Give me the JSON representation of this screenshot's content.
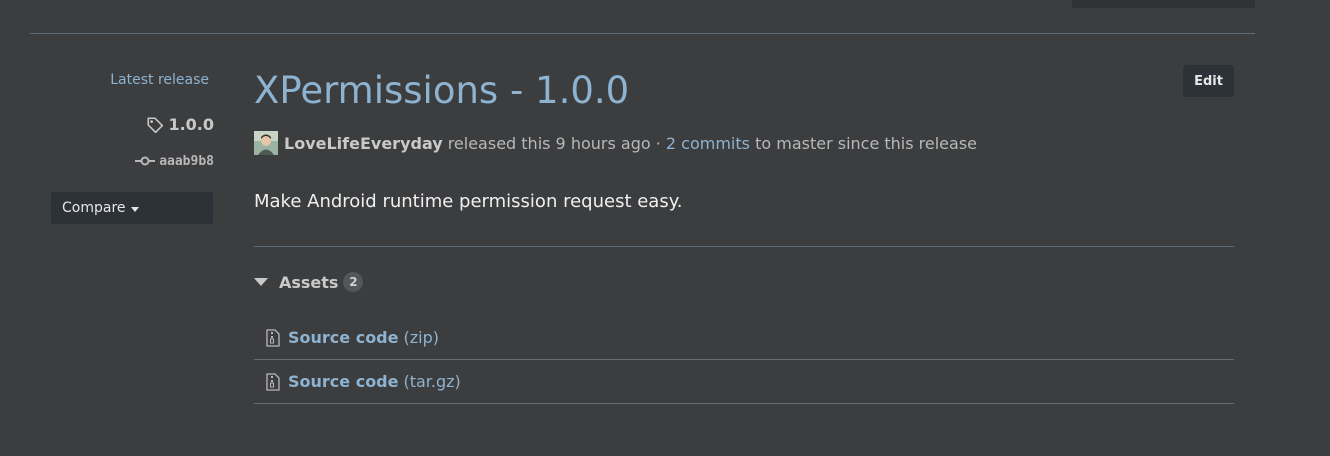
{
  "sidebar": {
    "latest_label": "Latest release",
    "tag": "1.0.0",
    "commit": "aaab9b8",
    "compare_label": "Compare"
  },
  "release": {
    "title": "XPermissions - 1.0.0",
    "edit_label": "Edit",
    "author": "LoveLifeEveryday",
    "released_text": "released this 9 hours ago ·",
    "commits_link": "2 commits",
    "since_text": "to master since this release",
    "description": "Make Android runtime permission request easy."
  },
  "assets": {
    "label": "Assets",
    "count": "2",
    "items": [
      {
        "name": "Source code",
        "ext": "(zip)"
      },
      {
        "name": "Source code",
        "ext": "(tar.gz)"
      }
    ]
  },
  "colors": {
    "background": "#3c3d3f",
    "link": "#8db3d1",
    "button": "#2d3238"
  }
}
